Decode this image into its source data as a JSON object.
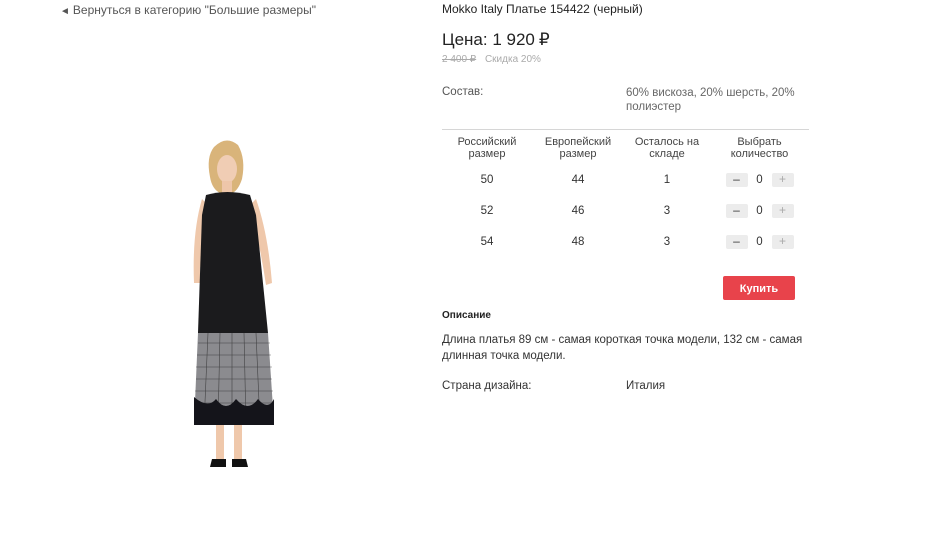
{
  "nav": {
    "back_label": "Вернуться в категорию \"Большие размеры\""
  },
  "product": {
    "title": "Mokko Italy Платье 154422 (черный)",
    "price_label": "Цена: 1 920",
    "currency": "₽",
    "old_price": "2 400 ₽",
    "discount": "Скидка 20%",
    "composition_label": "Состав:",
    "composition_value": "60% вискоза, 20% шерсть, 20% полиэстер"
  },
  "size_table": {
    "headers": [
      "Российский размер",
      "Европейский размер",
      "Осталось на складе",
      "Выбрать количество"
    ],
    "rows": [
      {
        "ru": "50",
        "eu": "44",
        "stock": "1",
        "qty": "0"
      },
      {
        "ru": "52",
        "eu": "46",
        "stock": "3",
        "qty": "0"
      },
      {
        "ru": "54",
        "eu": "48",
        "stock": "3",
        "qty": "0"
      }
    ],
    "minus": "–",
    "plus": "+"
  },
  "actions": {
    "buy_label": "Купить"
  },
  "description": {
    "heading": "Описание",
    "text": "Длина платья 89 см - самая короткая точка модели, 132 см - самая длинная точка модели."
  },
  "country": {
    "label": "Страна дизайна:",
    "value": "Италия"
  },
  "colors": {
    "accent": "#e8434b"
  }
}
